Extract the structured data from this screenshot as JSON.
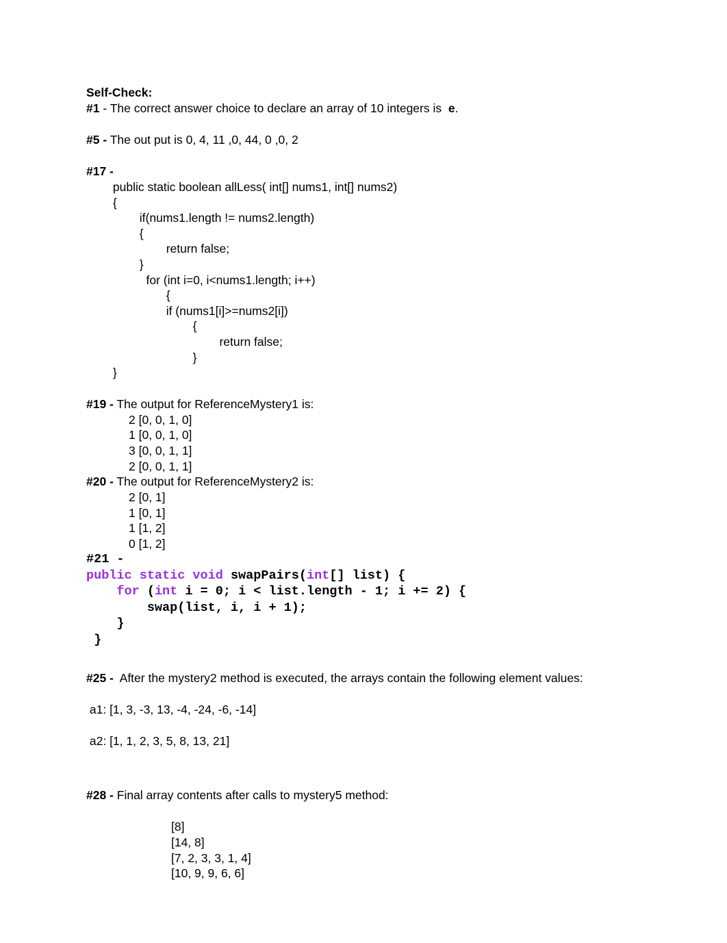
{
  "document": {
    "heading": "Self-Check:",
    "sections": {
      "q1": {
        "number": "#1",
        "text_before": " - The correct answer choice to declare an array of 10 integers is  ",
        "answer": "e",
        "text_after": "."
      },
      "q5": {
        "number": "#5 -",
        "text": " The out put is 0, 4, 11 ,0, 44, 0 ,0, 2"
      },
      "q17": {
        "number": "#17 -",
        "code_lines": [
          "        public static boolean allLess( int[] nums1, int[] nums2)",
          "        {",
          "                if(nums1.length != nums2.length)",
          "                {",
          "                        return false;",
          "                }",
          "                  for (int i=0, i<nums1.length; i++)",
          "                        {",
          "                        if (nums1[i]>=nums2[i])",
          "                                {",
          "                                        return false;",
          "                                }",
          "        }"
        ]
      },
      "q19": {
        "number": "#19 -",
        "text": " The output for ReferenceMystery1 is:",
        "output": [
          "2 [0, 0, 1, 0]",
          "1 [0, 0, 1, 0]",
          "3 [0, 0, 1, 1]",
          "2 [0, 0, 1, 1]"
        ]
      },
      "q20": {
        "number": "#20 -",
        "text": " The output for ReferenceMystery2 is:",
        "output": [
          "2 [0, 1]",
          "1 [0, 1]",
          "1 [1, 2]",
          "0 [1, 2]"
        ]
      },
      "q21": {
        "number": "#21 -",
        "code_tokens": [
          [
            {
              "t": "public static void ",
              "k": true
            },
            {
              "t": "swapPairs(",
              "k": false
            },
            {
              "t": "int",
              "k": true
            },
            {
              "t": "[] list) {",
              "k": false
            }
          ],
          [
            {
              "t": "    ",
              "k": false
            },
            {
              "t": "for ",
              "k": true
            },
            {
              "t": "(",
              "k": false
            },
            {
              "t": "int",
              "k": true
            },
            {
              "t": " i = 0; i < list.length - 1; i += 2) {",
              "k": false
            }
          ],
          [
            {
              "t": "        swap(list, i, i + 1);",
              "k": false
            }
          ],
          [
            {
              "t": "    }",
              "k": false
            }
          ],
          [
            {
              "t": " }",
              "k": false
            }
          ]
        ]
      },
      "q25": {
        "number": "#25 -",
        "text": "  After the mystery2 method is executed, the arrays contain the following element values:",
        "a1": " a1: [1, 3, -3, 13, -4, -24, -6, -14]",
        "a2": " a2: [1, 1, 2, 3, 5, 8, 13, 21]"
      },
      "q28": {
        "number": "#28 -",
        "text": " Final array contents after calls to mystery5 method:",
        "output": [
          "[8]",
          "[14, 8]",
          "[7, 2, 3, 3, 1, 4]",
          "[10, 9, 9, 6, 6]"
        ]
      }
    },
    "colors": {
      "text": "#000000",
      "keyword_purple": "#9b30e0",
      "background": "#ffffff"
    }
  }
}
